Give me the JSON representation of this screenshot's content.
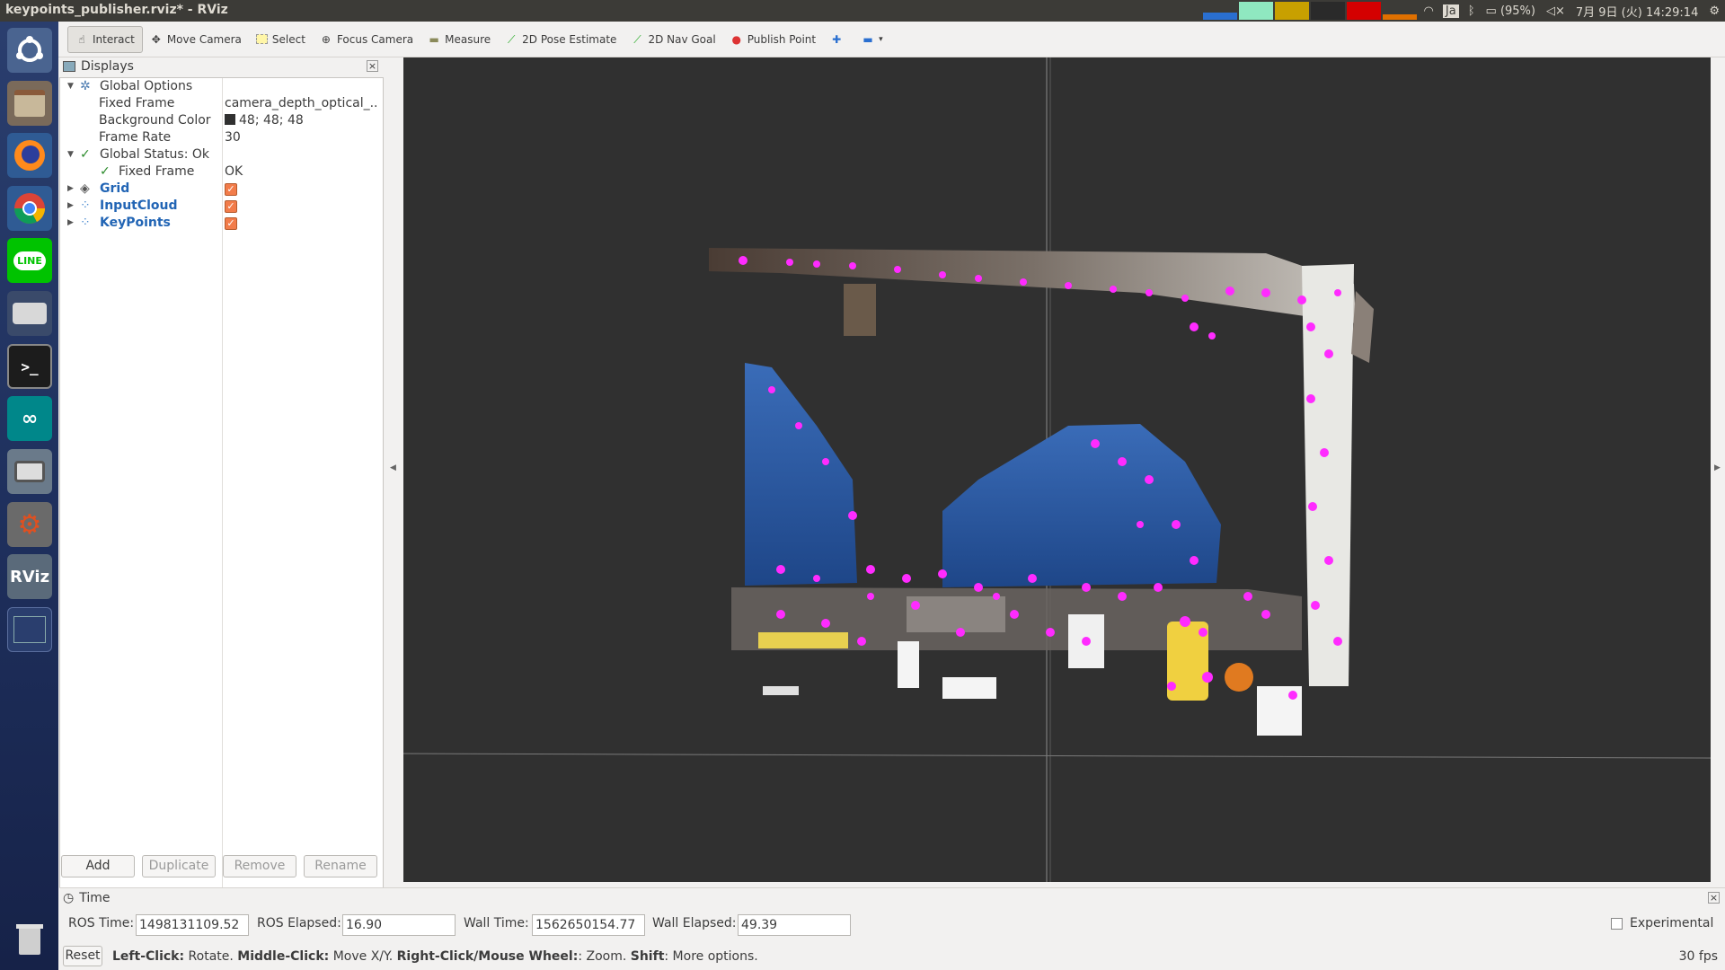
{
  "window": {
    "title": "keypoints_publisher.rviz* - RViz"
  },
  "tray": {
    "battery": "(95%)",
    "clock": "7月 9日 (火) 14:29:14",
    "input_method": "Ja"
  },
  "launcher": {
    "rviz_label": "RViz",
    "line_label": "LINE"
  },
  "toolbar": {
    "items": [
      "Interact",
      "Move Camera",
      "Select",
      "Focus Camera",
      "Measure",
      "2D Pose Estimate",
      "2D Nav Goal",
      "Publish Point"
    ]
  },
  "displays": {
    "title": "Displays",
    "rows": [
      {
        "key": "Global Options",
        "value": ""
      },
      {
        "key": "Fixed Frame",
        "value": "camera_depth_optical_..."
      },
      {
        "key": "Background Color",
        "value": "48; 48; 48"
      },
      {
        "key": "Frame Rate",
        "value": "30"
      },
      {
        "key": "Global Status: Ok",
        "value": ""
      },
      {
        "key": "Fixed Frame",
        "value": "OK"
      },
      {
        "key": "Grid",
        "value": ""
      },
      {
        "key": "InputCloud",
        "value": ""
      },
      {
        "key": "KeyPoints",
        "value": ""
      }
    ],
    "buttons": {
      "add": "Add",
      "duplicate": "Duplicate",
      "remove": "Remove",
      "rename": "Rename"
    }
  },
  "time": {
    "title": "Time",
    "ros_time_label": "ROS Time:",
    "ros_time": "1498131109.52",
    "ros_elapsed_label": "ROS Elapsed:",
    "ros_elapsed": "16.90",
    "wall_time_label": "Wall Time:",
    "wall_time": "1562650154.77",
    "wall_elapsed_label": "Wall Elapsed:",
    "wall_elapsed": "49.39",
    "experimental": "Experimental"
  },
  "status": {
    "reset": "Reset",
    "hint_left_key": "Left-Click:",
    "hint_left": " Rotate. ",
    "hint_middle_key": "Middle-Click:",
    "hint_middle": " Move X/Y. ",
    "hint_right_key": "Right-Click/Mouse Wheel:",
    "hint_right": ": Zoom. ",
    "hint_shift_key": "Shift",
    "hint_shift": ": More options.",
    "fps": "30 fps"
  },
  "colors": {
    "viewport_bg": "#303030",
    "keypoint": "#ff2bff",
    "tree_blue": "#2265b5",
    "checkbox": "#f27c4a"
  }
}
